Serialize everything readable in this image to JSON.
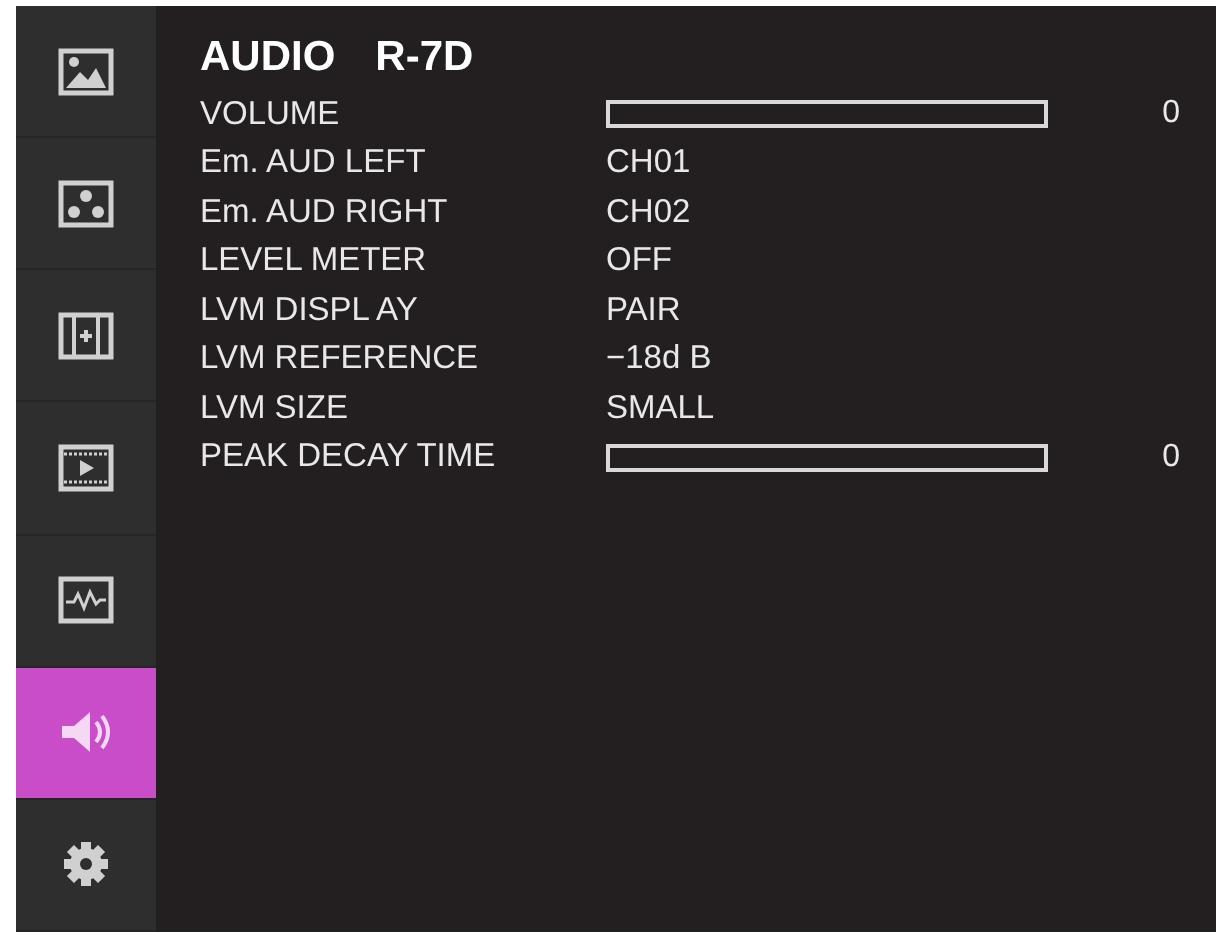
{
  "sidebar": {
    "items": [
      {
        "kind": "picture",
        "selected": false
      },
      {
        "kind": "dots",
        "selected": false
      },
      {
        "kind": "frame",
        "selected": false
      },
      {
        "kind": "film",
        "selected": false
      },
      {
        "kind": "wave",
        "selected": false
      },
      {
        "kind": "speaker",
        "selected": true
      },
      {
        "kind": "gear",
        "selected": false
      }
    ]
  },
  "menu": {
    "title": "AUDIO",
    "model": "R-7D",
    "rows": [
      {
        "kind": "slider",
        "label": "VOLUME",
        "level": 0,
        "reading": "0"
      },
      {
        "kind": "value",
        "label": "Em. AUD LEFT",
        "value": "CH01"
      },
      {
        "kind": "value",
        "label": "Em. AUD RIGHT",
        "value": "CH02"
      },
      {
        "kind": "value",
        "label": "LEVEL METER",
        "value": "OFF"
      },
      {
        "kind": "value",
        "label": "LVM DISPL AY",
        "value": "PAIR"
      },
      {
        "kind": "value",
        "label": "LVM REFERENCE",
        "value": "−18d B"
      },
      {
        "kind": "value",
        "label": "LVM SIZE",
        "value": "SMALL"
      },
      {
        "kind": "slider",
        "label": "PEAK DECAY TIME",
        "level": 0,
        "reading": "0"
      }
    ]
  }
}
